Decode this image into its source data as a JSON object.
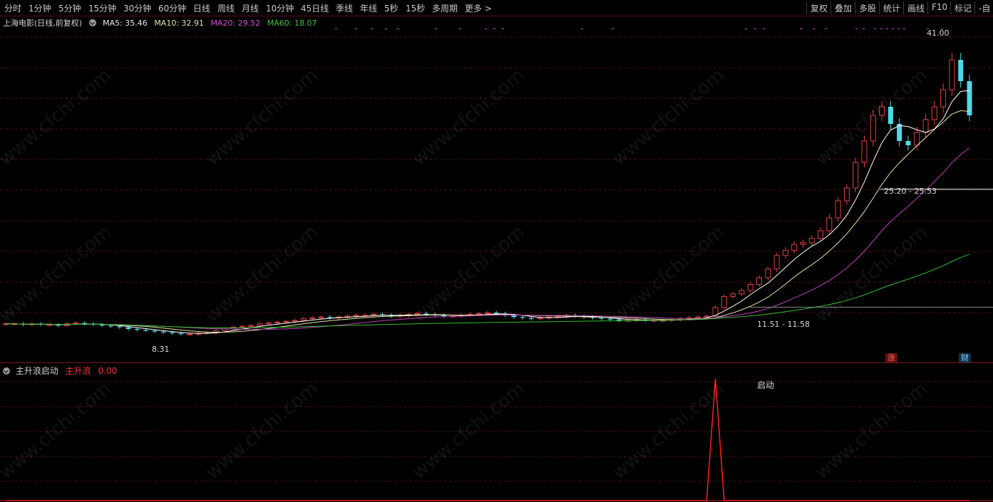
{
  "toolbar": {
    "periods": [
      "分时",
      "1分钟",
      "5分钟",
      "15分钟",
      "30分钟",
      "60分钟",
      "日线",
      "周线",
      "月线",
      "10分钟",
      "45日线",
      "季线",
      "年线",
      "5秒",
      "15秒",
      "多周期",
      "更多 >"
    ],
    "right": [
      "复权",
      "叠加",
      "多股",
      "统计",
      "画线",
      "F10",
      "标记",
      "-自"
    ]
  },
  "info": {
    "title": "上海电影(日线,前复权)",
    "ma5": "MA5: 35.46",
    "ma10": "MA10: 32.91",
    "ma20": "MA20: 29.52",
    "ma60": "MA60: 18.07"
  },
  "colors": {
    "ma5": "#ffffff",
    "ma10": "#e6e6a0",
    "ma20": "#c040c0",
    "ma60": "#2fbf2f",
    "up": "#e04040",
    "down": "#50d8e8",
    "grid": "#4a0f14"
  },
  "labels": {
    "high": "41.00",
    "low": "8.31",
    "band1": "25.20 - 25.53",
    "band2": "11.51 - 11.58",
    "tag_zhang": "涨",
    "tag_cai": "财",
    "signal": "启动"
  },
  "sub": {
    "name": "主升浪启动",
    "series": "主升浪",
    "value": "0.00"
  },
  "watermark": "www.cfchi.com",
  "chart_data": {
    "type": "candlestick",
    "title": "上海电影(日线,前复权)",
    "ma": {
      "MA5": 35.46,
      "MA10": 32.91,
      "MA20": 29.52,
      "MA60": 18.07
    },
    "high": 41.0,
    "low": 8.31,
    "close_series": [
      9.6,
      9.6,
      9.5,
      9.6,
      9.5,
      9.5,
      9.4,
      9.6,
      9.7,
      9.6,
      9.5,
      9.4,
      9.3,
      9.2,
      9.0,
      8.9,
      8.8,
      8.7,
      8.6,
      8.5,
      8.4,
      8.4,
      8.5,
      8.6,
      8.8,
      9.0,
      9.2,
      9.3,
      9.4,
      9.6,
      9.7,
      9.8,
      9.9,
      10.0,
      10.2,
      10.3,
      10.4,
      10.3,
      10.4,
      10.5,
      10.6,
      10.6,
      10.7,
      10.6,
      10.5,
      10.6,
      10.7,
      10.8,
      10.7,
      10.6,
      10.5,
      10.5,
      10.6,
      10.7,
      10.8,
      10.9,
      10.8,
      10.6,
      10.4,
      10.3,
      10.2,
      10.3,
      10.4,
      10.5,
      10.6,
      10.5,
      10.4,
      10.3,
      10.2,
      10.1,
      10.0,
      10.0,
      10.1,
      10.0,
      10.0,
      10.0,
      10.1,
      10.2,
      10.3,
      10.4,
      10.5,
      11.5,
      12.8,
      13.1,
      13.5,
      14.2,
      15.0,
      16.0,
      17.6,
      18.2,
      18.9,
      19.1,
      19.6,
      20.5,
      22.0,
      24.0,
      25.5,
      28.5,
      31.0,
      34.0,
      35.0,
      33.0,
      31.0,
      30.5,
      32.0,
      33.5,
      35.0,
      37.0,
      40.5,
      38.0,
      34.0
    ],
    "signal": [
      0,
      0,
      0,
      0,
      0,
      0,
      0,
      0,
      0,
      0,
      0,
      0,
      0,
      0,
      0,
      0,
      0,
      0,
      0,
      0,
      0,
      0,
      0,
      0,
      0,
      0,
      0,
      0,
      0,
      0,
      0,
      0,
      0,
      0,
      0,
      0,
      0,
      0,
      0,
      0,
      0,
      0,
      0,
      0,
      0,
      0,
      0,
      0,
      0,
      0,
      0,
      0,
      0,
      0,
      0,
      0,
      0,
      0,
      0,
      0,
      0,
      0,
      0,
      0,
      0,
      0,
      0,
      0,
      0,
      0,
      0,
      0,
      0,
      0,
      0,
      0,
      0,
      0,
      0,
      0,
      0,
      1,
      0,
      0,
      0,
      0,
      0,
      0,
      0,
      0,
      0,
      0,
      0,
      0,
      0,
      0,
      0,
      0,
      0,
      0,
      0,
      0,
      0,
      0,
      0,
      0,
      0,
      0,
      0,
      0,
      0
    ]
  }
}
